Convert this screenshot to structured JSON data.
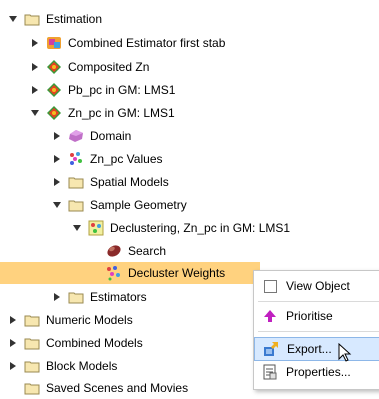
{
  "tree": {
    "items": [
      {
        "label": "Estimation",
        "icon": "folder-icon",
        "expanded": true
      },
      {
        "label": "Combined Estimator first stab",
        "icon": "combined-estimator-icon",
        "expanded": false
      },
      {
        "label": "Composited Zn",
        "icon": "points-icon",
        "expanded": false
      },
      {
        "label": "Pb_pc in GM: LMS1",
        "icon": "points-icon",
        "expanded": false
      },
      {
        "label": "Zn_pc in GM: LMS1",
        "icon": "points-icon",
        "expanded": true
      },
      {
        "label": "Domain",
        "icon": "domain-icon",
        "expanded": false
      },
      {
        "label": "Zn_pc Values",
        "icon": "values-icon",
        "expanded": false
      },
      {
        "label": "Spatial Models",
        "icon": "folder-icon",
        "expanded": false
      },
      {
        "label": "Sample Geometry",
        "icon": "folder-icon",
        "expanded": true
      },
      {
        "label": "Declustering, Zn_pc in GM: LMS1",
        "icon": "declustering-icon",
        "expanded": true
      },
      {
        "label": "Search",
        "icon": "search-ellipsoid-icon"
      },
      {
        "label": "Decluster Weights",
        "icon": "weights-icon",
        "selected": true
      },
      {
        "label": "Estimators",
        "icon": "folder-icon",
        "expanded": false
      },
      {
        "label": "Numeric Models",
        "icon": "folder-icon",
        "expanded": false
      },
      {
        "label": "Combined Models",
        "icon": "folder-icon",
        "expanded": false
      },
      {
        "label": "Block Models",
        "icon": "folder-icon",
        "expanded": false
      },
      {
        "label": "Saved Scenes and Movies",
        "icon": "folder-icon"
      }
    ]
  },
  "context_menu": {
    "items": [
      {
        "label": "View Object",
        "icon": "checkbox-icon"
      },
      {
        "label": "Prioritise",
        "icon": "up-arrow-icon"
      },
      {
        "label": "Export...",
        "icon": "export-icon",
        "highlighted": true
      },
      {
        "label": "Properties...",
        "icon": "properties-icon"
      }
    ]
  },
  "colors": {
    "selection": "#ffd27f",
    "menu_highlight": "#d7e9ff",
    "folder": "#e8c86a"
  }
}
